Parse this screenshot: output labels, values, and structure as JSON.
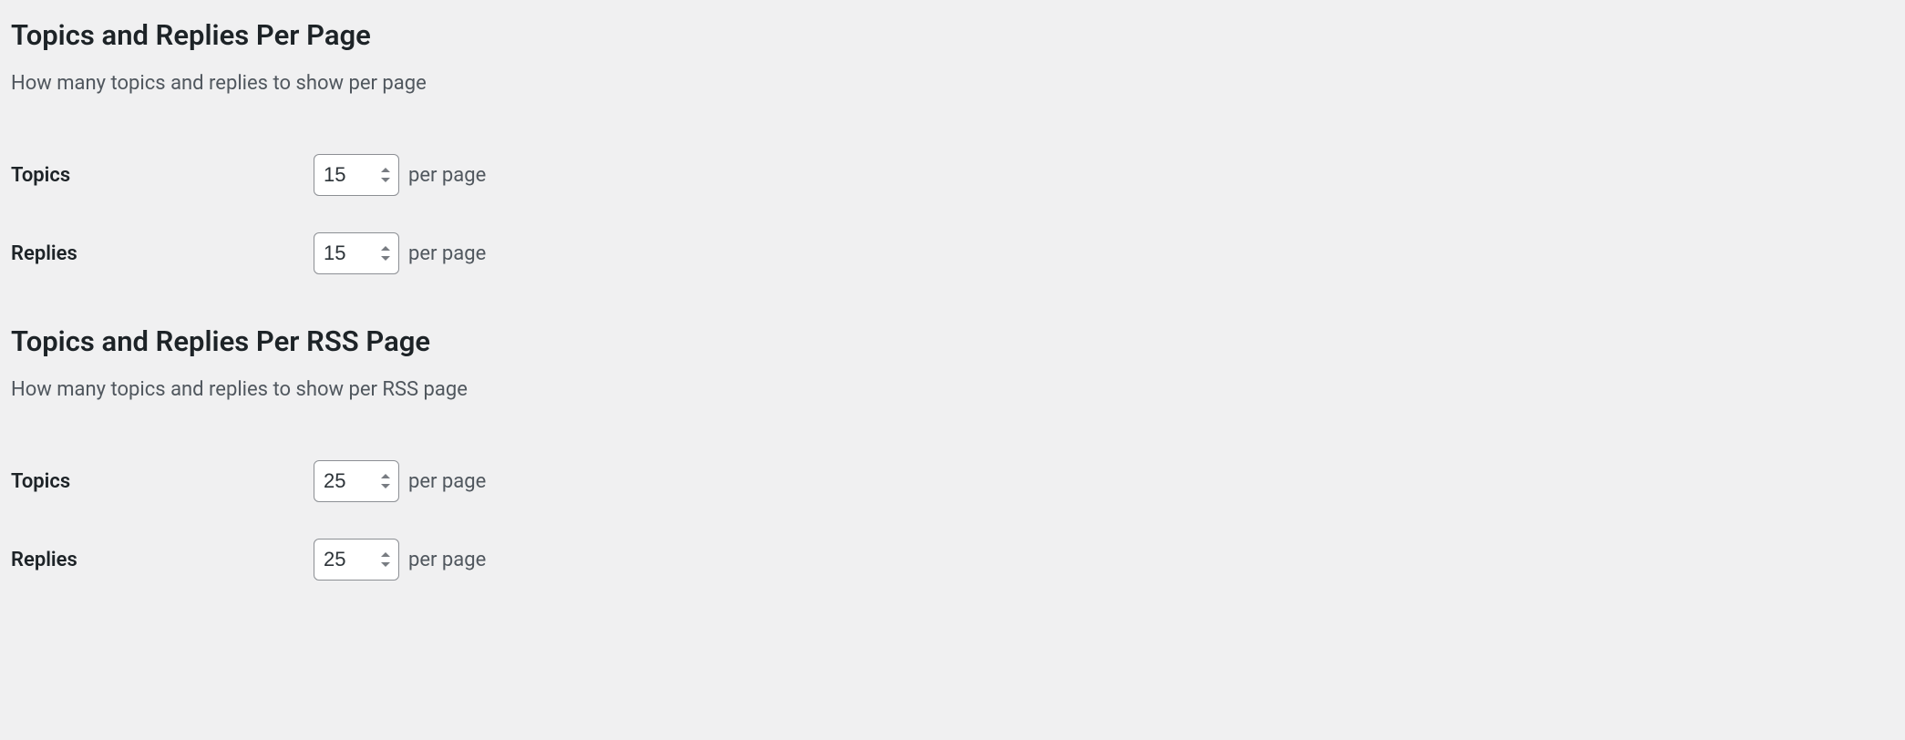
{
  "sections": {
    "per_page": {
      "heading": "Topics and Replies Per Page",
      "description": "How many topics and replies to show per page",
      "fields": {
        "topics": {
          "label": "Topics",
          "value": "15",
          "suffix": "per page"
        },
        "replies": {
          "label": "Replies",
          "value": "15",
          "suffix": "per page"
        }
      }
    },
    "per_rss": {
      "heading": "Topics and Replies Per RSS Page",
      "description": "How many topics and replies to show per RSS page",
      "fields": {
        "topics": {
          "label": "Topics",
          "value": "25",
          "suffix": "per page"
        },
        "replies": {
          "label": "Replies",
          "value": "25",
          "suffix": "per page"
        }
      }
    }
  }
}
